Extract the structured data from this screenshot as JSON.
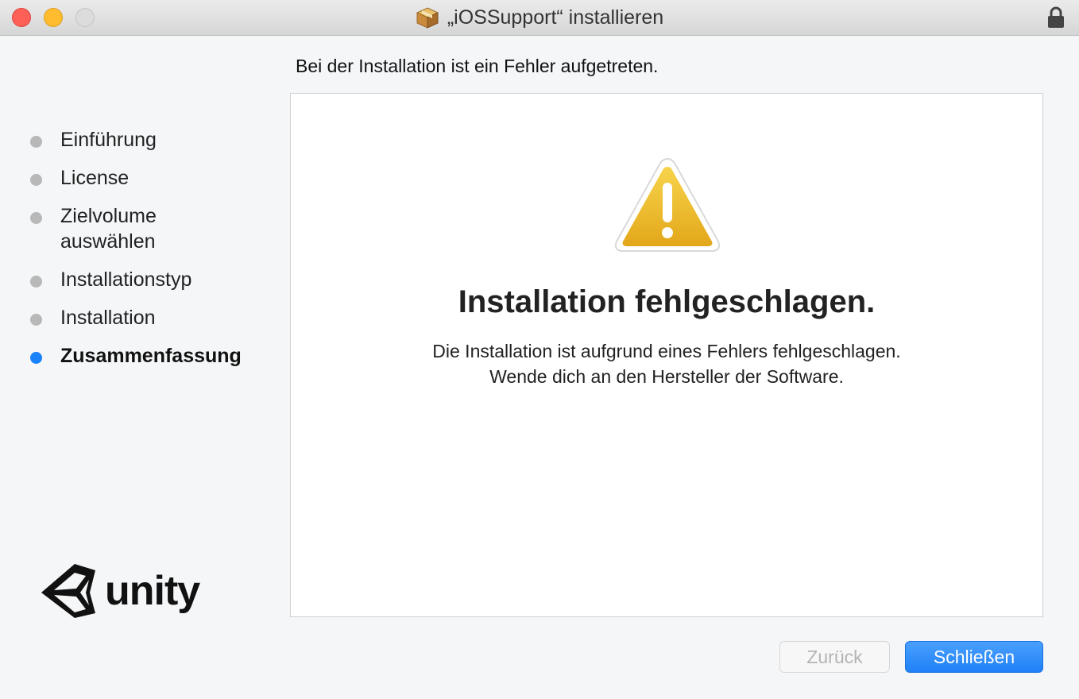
{
  "window": {
    "title": "„iOSSupport“ installieren"
  },
  "heading": "Bei der Installation ist ein Fehler aufgetreten.",
  "sidebar": {
    "steps": [
      {
        "label": "Einführung",
        "active": false
      },
      {
        "label": "License",
        "active": false
      },
      {
        "label": "Zielvolume\nauswählen",
        "active": false
      },
      {
        "label": "Installationstyp",
        "active": false
      },
      {
        "label": "Installation",
        "active": false
      },
      {
        "label": "Zusammenfassung",
        "active": true
      }
    ]
  },
  "logo": {
    "text": "unity"
  },
  "content": {
    "title": "Installation fehlgeschlagen.",
    "description_line1": "Die Installation ist aufgrund eines Fehlers fehlgeschlagen.",
    "description_line2": "Wende dich an den Hersteller der Software."
  },
  "buttons": {
    "back_label": "Zurück",
    "close_label": "Schließen"
  },
  "colors": {
    "accent": "#1a82fb",
    "close_light": "#fe5f57",
    "minimize_light": "#febc2e",
    "warning": "#f0c419"
  },
  "icons": {
    "window_icon": "package-icon",
    "lock": "lock-icon",
    "warning": "warning-icon",
    "logo": "unity-logo-icon"
  }
}
